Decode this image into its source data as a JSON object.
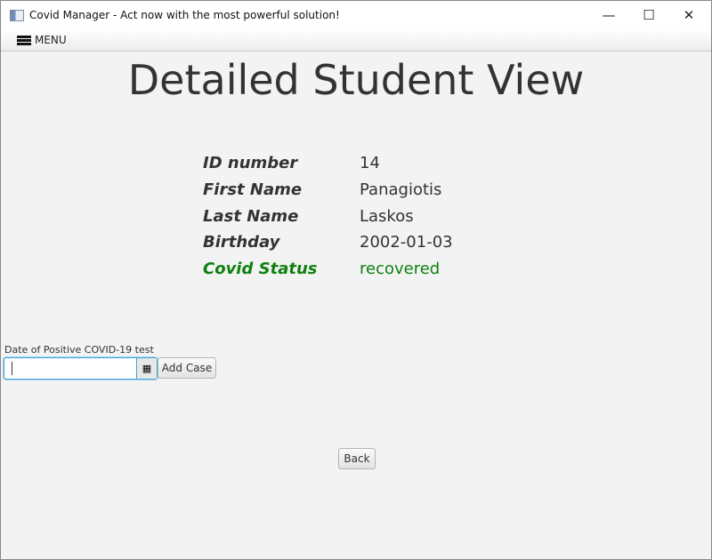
{
  "window": {
    "title": "Covid Manager - Act now with the most powerful solution!",
    "minimize": "—",
    "maximize": "☐",
    "close": "✕"
  },
  "menu": {
    "label": "MENU",
    "icon": "hamburger-icon"
  },
  "page_title": "Detailed Student View",
  "fields": [
    {
      "label": "ID number",
      "value": "14"
    },
    {
      "label": "First Name",
      "value": "Panagiotis"
    },
    {
      "label": "Last Name",
      "value": "Laskos"
    },
    {
      "label": "Birthday",
      "value": "2002-01-03"
    },
    {
      "label": "Covid Status",
      "value": "recovered",
      "color": "#108010"
    }
  ],
  "date_field": {
    "label": "Date of Positive COVID-19 test",
    "value": "",
    "icon": "calendar-icon"
  },
  "add_case_label": "Add Case",
  "back_label": "Back"
}
